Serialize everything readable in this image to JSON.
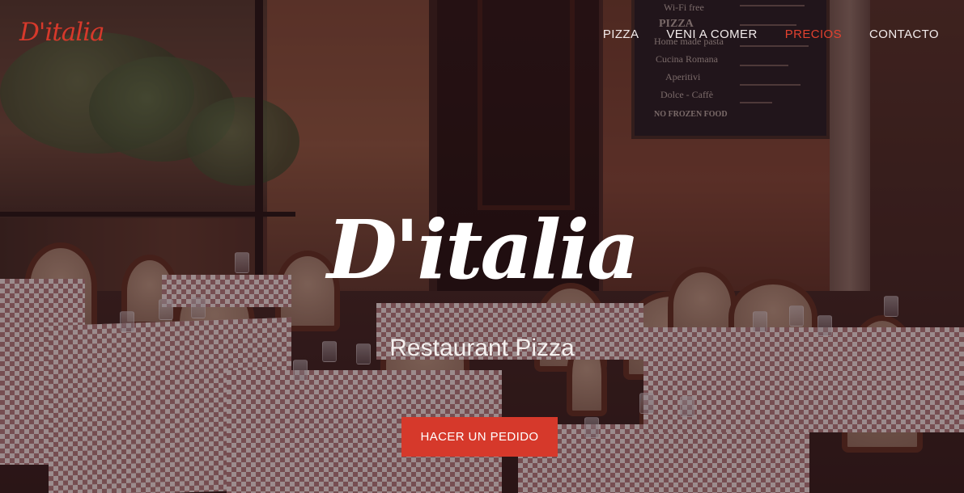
{
  "brand": {
    "logo_text": "D'italia",
    "accent_color": "#d6392b"
  },
  "nav": {
    "items": [
      {
        "label": "PIZZA",
        "active": false
      },
      {
        "label": "VENI A COMER",
        "active": false
      },
      {
        "label": "PRECIOS",
        "active": true
      },
      {
        "label": "CONTACTO",
        "active": false
      }
    ]
  },
  "hero": {
    "title": "D'italia",
    "subtitle": "Restaurant Pizza",
    "cta_label": "HACER UN PEDIDO",
    "background_description_icon": "restaurant-terrace-photo"
  },
  "menu_board": {
    "lines": [
      "Wi-Fi free",
      "PIZZA",
      "Home made pasta",
      "Cucina Romana",
      "Aperitivi",
      "Dolce - Caffè",
      "NO FROZEN FOOD"
    ]
  }
}
